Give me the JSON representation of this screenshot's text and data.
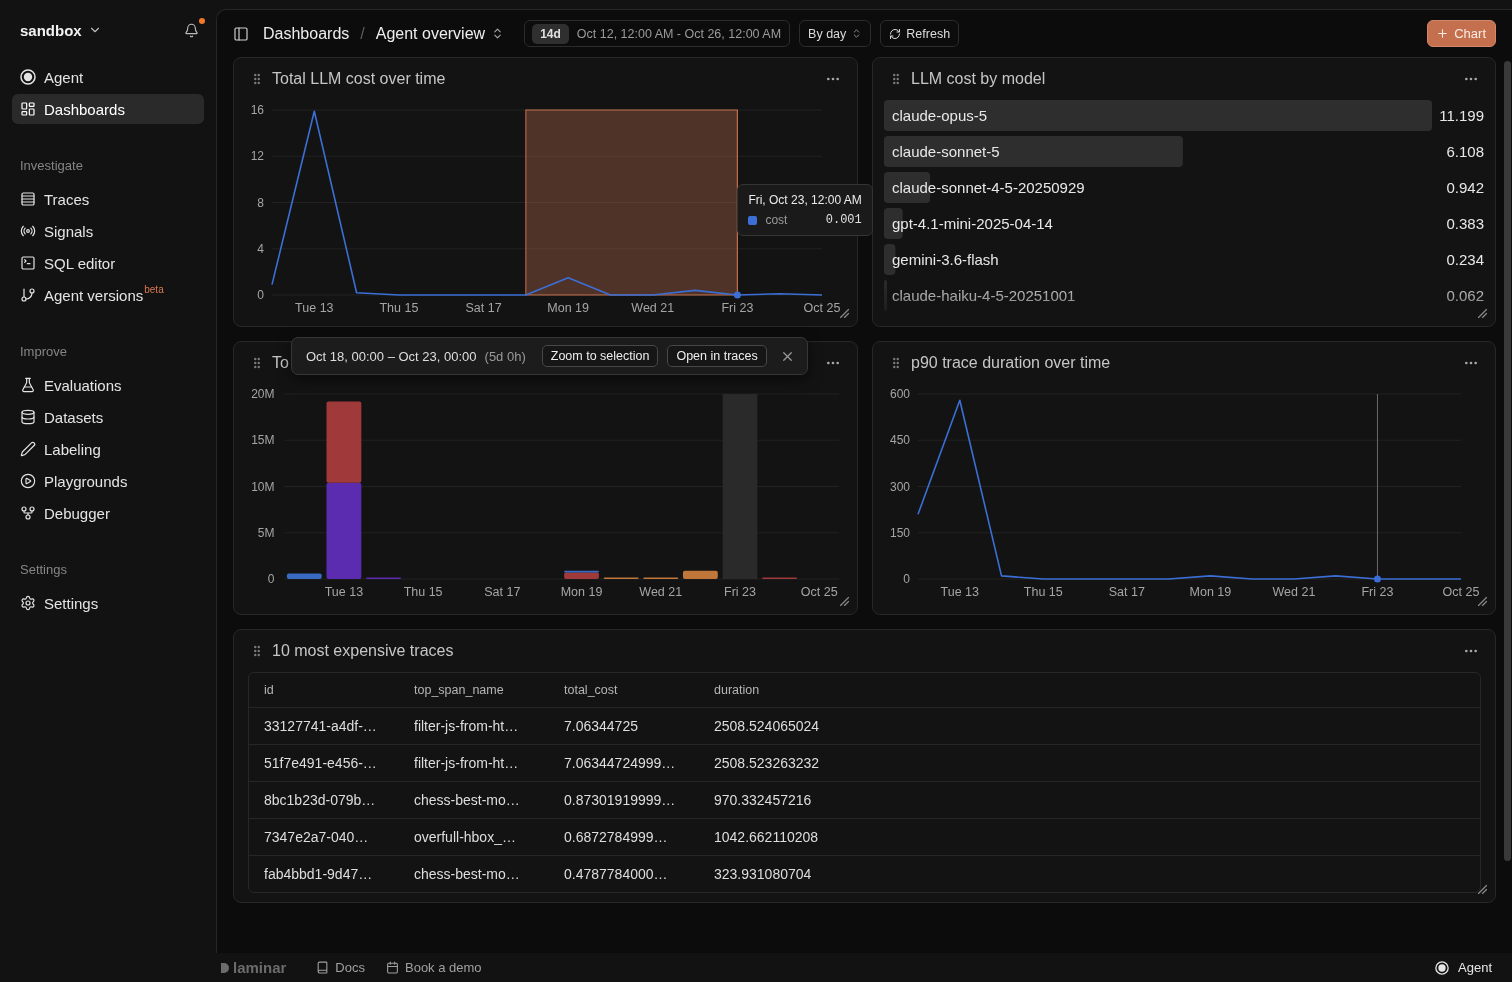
{
  "sidebar": {
    "workspace": "sandbox",
    "unread": true,
    "groups": [
      {
        "items": [
          {
            "label": "Agent",
            "selected": false
          },
          {
            "label": "Dashboards",
            "selected": true
          }
        ]
      },
      {
        "title": "Investigate",
        "items": [
          {
            "label": "Traces",
            "selected": false
          },
          {
            "label": "Signals",
            "selected": false
          },
          {
            "label": "SQL editor",
            "selected": false
          },
          {
            "label": "Agent versions",
            "badge": "beta",
            "selected": false
          }
        ]
      },
      {
        "title": "Improve",
        "items": [
          {
            "label": "Evaluations",
            "selected": false
          },
          {
            "label": "Datasets",
            "selected": false
          },
          {
            "label": "Labeling",
            "selected": false
          },
          {
            "label": "Playgrounds",
            "selected": false
          },
          {
            "label": "Debugger",
            "selected": false
          }
        ]
      },
      {
        "title": "Settings",
        "items": [
          {
            "label": "Settings",
            "selected": false
          }
        ]
      }
    ]
  },
  "header": {
    "breadcrumb": [
      "Dashboards",
      "Agent overview"
    ],
    "separator": "/",
    "range": {
      "preset": "14d",
      "label": "Oct 12, 12:00 AM - Oct 26, 12:00 AM"
    },
    "granularity": "By day",
    "refresh": "Refresh",
    "add_button": "Chart"
  },
  "widgets": [
    {
      "title": "Total LLM cost over time",
      "chart_data": [
        {
          "type": "line",
          "x": [
            "--10-12",
            "--10-13",
            "--10-14",
            "--10-15",
            "--10-16",
            "--10-17",
            "--10-18",
            "--10-19",
            "--10-20",
            "--10-21",
            "--10-22",
            "--10-23",
            "--10-24",
            "--10-25"
          ],
          "values": [
            0.9,
            15.9,
            0.2,
            0,
            0,
            0,
            0,
            1.5,
            0,
            0,
            0.4,
            0,
            0.1,
            0
          ],
          "color": "#3b6fd6",
          "xlim": [
            "--10-12",
            "--10-25"
          ],
          "ylim": [
            0,
            16
          ],
          "yticks": [
            0,
            4,
            8,
            12,
            16
          ],
          "xticks": [
            {
              "value": "--10-13",
              "label": "Tue 13"
            },
            {
              "value": "--10-15",
              "label": "Thu 15"
            },
            {
              "value": "--10-17",
              "label": "Sat 17"
            },
            {
              "value": "--10-19",
              "label": "Mon 19"
            },
            {
              "value": "--10-21",
              "label": "Wed 21"
            },
            {
              "value": "--10-23",
              "label": "Fri 23"
            },
            {
              "value": "--10-25",
              "label": "Oct 25"
            }
          ],
          "grid": true,
          "bands": [
            {
              "axis": "x",
              "from": "--10-18",
              "to": "--10-23",
              "color": "#c4704f"
            }
          ],
          "ref_lines": [
            {
              "axis": "x",
              "value": "--10-23",
              "color": "#c4704f"
            }
          ]
        }
      ],
      "tooltip": {
        "title": "Fri, Oct 23, 12:00 AM",
        "label": "cost",
        "value": "0.001"
      }
    },
    {
      "title": "LLM cost by model",
      "chart_data": [
        {
          "type": "bar",
          "orientation": "horizontal",
          "categories": [
            "claude-opus-5",
            "claude-sonnet-5",
            "claude-sonnet-4-5-20250929",
            "gpt-4.1-mini-2025-04-14",
            "gemini-3.6-flash",
            "claude-haiku-4-5-20251001"
          ],
          "values": [
            11.199,
            6.108,
            0.942,
            0.383,
            0.234,
            0.062
          ],
          "color": "#2e2e2e",
          "data_labels": true
        }
      ]
    },
    {
      "title": "To",
      "chart_data": [
        {
          "type": "bar",
          "stacked": true,
          "x": [
            "--10-12",
            "--10-13",
            "--10-14",
            "--10-15",
            "--10-16",
            "--10-17",
            "--10-18",
            "--10-19",
            "--10-20",
            "--10-21",
            "--10-22",
            "--10-23",
            "--10-24"
          ],
          "series": [
            {
              "color": "#5b2bb0",
              "values": [
                null,
                10400000,
                100000,
                null,
                null,
                null,
                null,
                null,
                null,
                null,
                null,
                null,
                null
              ]
            },
            {
              "color": "#a0393a",
              "values": [
                null,
                8800000,
                null,
                null,
                null,
                null,
                null,
                700000,
                null,
                null,
                null,
                null,
                100000
              ]
            },
            {
              "color": "#3a6bc4",
              "values": [
                600000,
                null,
                null,
                null,
                null,
                null,
                null,
                200000,
                null,
                null,
                null,
                null,
                null
              ]
            },
            {
              "color": "#c2773a",
              "values": [
                null,
                null,
                null,
                null,
                null,
                null,
                null,
                null,
                100000,
                100000,
                900000,
                null,
                null
              ]
            }
          ],
          "xlim": [
            "--10-11T12:00",
            "--10-25T12:00"
          ],
          "ylim": [
            0,
            20000000
          ],
          "yticks": [
            {
              "value": 0,
              "label": "0"
            },
            {
              "value": 5000000,
              "label": "5M"
            },
            {
              "value": 10000000,
              "label": "10M"
            },
            {
              "value": 15000000,
              "label": "15M"
            },
            {
              "value": 20000000,
              "label": "20M"
            }
          ],
          "xticks": [
            {
              "value": "--10-13",
              "label": "Tue 13"
            },
            {
              "value": "--10-15",
              "label": "Thu 15"
            },
            {
              "value": "--10-17",
              "label": "Sat 17"
            },
            {
              "value": "--10-19",
              "label": "Mon 19"
            },
            {
              "value": "--10-21",
              "label": "Wed 21"
            },
            {
              "value": "--10-23",
              "label": "Fri 23"
            },
            {
              "value": "--10-25",
              "label": "Oct 25"
            }
          ],
          "grid": true,
          "bands": [
            {
              "axis": "x",
              "from": "--10-22T13:30",
              "to": "--10-23T10:30",
              "color": "#2a2a2a"
            }
          ]
        }
      ],
      "selection": {
        "range": "Oct 18, 00:00 – Oct 23, 00:00",
        "duration": "(5d 0h)",
        "actions": [
          "Zoom to selection",
          "Open in traces"
        ]
      }
    },
    {
      "title": "p90 trace duration over time",
      "chart_data": [
        {
          "type": "line",
          "x": [
            "--10-12",
            "--10-13",
            "--10-14",
            "--10-15",
            "--10-16",
            "--10-17",
            "--10-18",
            "--10-19",
            "--10-20",
            "--10-21",
            "--10-22",
            "--10-23",
            "--10-24",
            "--10-25"
          ],
          "values": [
            210,
            580,
            10,
            0,
            0,
            0,
            0,
            10,
            0,
            0,
            10,
            0,
            0,
            0
          ],
          "color": "#3b6fd6",
          "xlim": [
            "--10-12",
            "--10-25"
          ],
          "ylim": [
            0,
            600
          ],
          "yticks": [
            0,
            150,
            300,
            450,
            600
          ],
          "xticks": [
            {
              "value": "--10-13",
              "label": "Tue 13"
            },
            {
              "value": "--10-15",
              "label": "Thu 15"
            },
            {
              "value": "--10-17",
              "label": "Sat 17"
            },
            {
              "value": "--10-19",
              "label": "Mon 19"
            },
            {
              "value": "--10-21",
              "label": "Wed 21"
            },
            {
              "value": "--10-23",
              "label": "Fri 23"
            },
            {
              "value": "--10-25",
              "label": "Oct 25"
            }
          ],
          "grid": true,
          "ref_lines": [
            {
              "axis": "x",
              "value": "--10-23",
              "color": "#6a6a6a"
            }
          ]
        }
      ]
    },
    {
      "title": "10 most expensive traces",
      "table": {
        "columns": [
          "id",
          "top_span_name",
          "total_cost",
          "duration"
        ],
        "rows": [
          [
            "33127741-a4df-…",
            "filter-js-from-ht…",
            "7.06344725",
            "2508.524065024"
          ],
          [
            "51f7e491-e456-…",
            "filter-js-from-ht…",
            "7.06344724999…",
            "2508.523263232"
          ],
          [
            "8bc1b23d-079b…",
            "chess-best-mo…",
            "0.87301919999…",
            "970.332457216"
          ],
          [
            "7347e2a7-040…",
            "overfull-hbox_…",
            "0.6872784999…",
            "1042.662110208"
          ],
          [
            "fab4bbd1-9d47…",
            "chess-best-mo…",
            "0.4787784000…",
            "323.931080704"
          ]
        ]
      }
    }
  ],
  "footer": {
    "logo": "laminar",
    "links": [
      "Docs",
      "Book a demo"
    ],
    "agent": "Agent"
  }
}
